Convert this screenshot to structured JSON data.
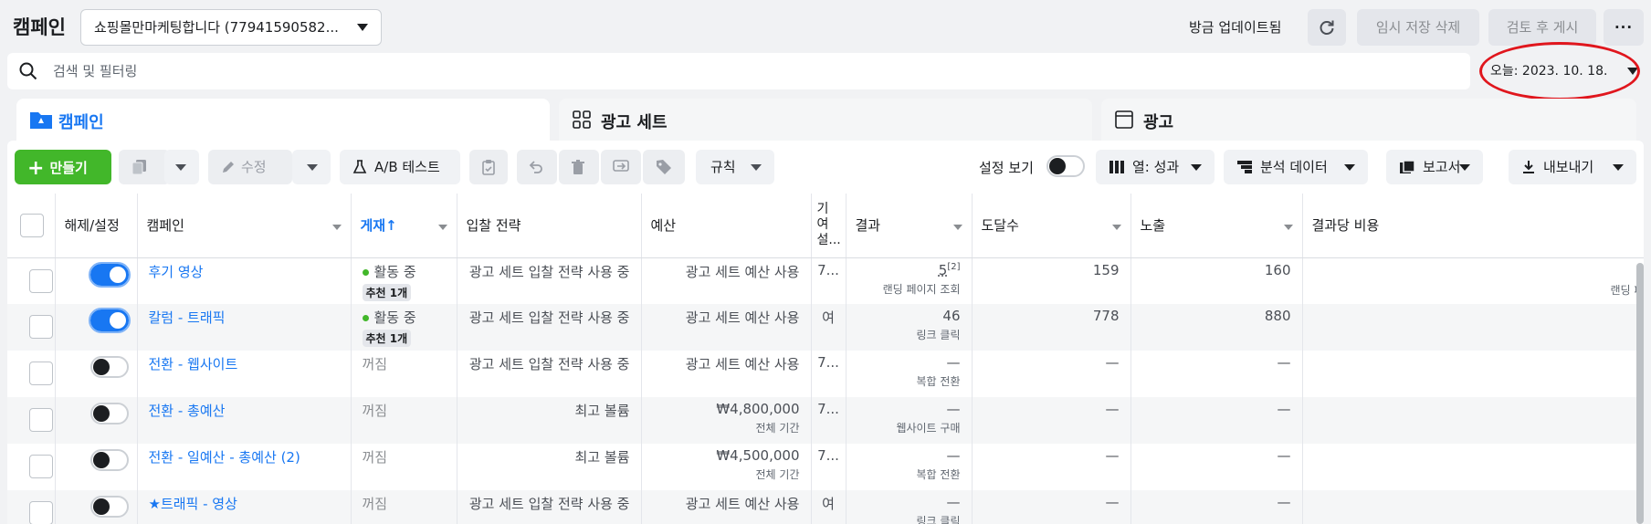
{
  "header": {
    "title": "캠페인",
    "account": "쇼핑몰만마케팅합니다 (77941590582...",
    "updated": "방금 업데이트됨",
    "discard_label": "임시 저장 삭제",
    "publish_label": "검토 후 게시",
    "more_label": "···"
  },
  "search": {
    "placeholder": "검색 및 필터링"
  },
  "date_range": "오늘: 2023. 10. 18.",
  "tabs": [
    {
      "label": "캠페인"
    },
    {
      "label": "광고 세트"
    },
    {
      "label": "광고"
    }
  ],
  "toolbar": {
    "create": "만들기",
    "edit": "수정",
    "ab_test": "A/B 테스트",
    "rules": "규칙",
    "setting_view": "설정 보기",
    "columns": "열: 성과",
    "analysis": "분석 데이터",
    "report": "보고서",
    "export": "내보내기"
  },
  "columns": [
    "해제/설정",
    "캠페인",
    "게재↑",
    "입찰 전략",
    "예산",
    "기여 설...",
    "결과",
    "도달수",
    "노출",
    "결과당 비용"
  ],
  "rows": [
    {
      "on": true,
      "name": "후기 영상",
      "status": "활동 중",
      "rec": "추천 1개",
      "bid": "광고 세트 입찰 전략 사용 중",
      "budget": "광고 세트 예산 사용",
      "budget_sub": "",
      "attr": "7...",
      "result": "5",
      "result_sup": "[2]",
      "result_sub": "랜딩 페이지 조회",
      "reach": "159",
      "impr": "160",
      "cpr": "",
      "cpr_sub": "랜딩 페이"
    },
    {
      "on": true,
      "name": "칼럼 - 트래픽",
      "status": "활동 중",
      "rec": "추천 1개",
      "bid": "광고 세트 입찰 전략 사용 중",
      "budget": "광고 세트 예산 사용",
      "budget_sub": "",
      "attr": "여",
      "result": "46",
      "result_sup": "",
      "result_sub": "링크 클릭",
      "reach": "778",
      "impr": "880",
      "cpr": "",
      "cpr_sub": ""
    },
    {
      "on": false,
      "name": "전환 - 웹사이트",
      "status": "꺼짐",
      "rec": "",
      "bid": "광고 세트 입찰 전략 사용 중",
      "budget": "광고 세트 예산 사용",
      "budget_sub": "",
      "attr": "7...",
      "result": "—",
      "result_sup": "",
      "result_sub": "복합 전환",
      "reach": "—",
      "impr": "—",
      "cpr": "",
      "cpr_sub": ""
    },
    {
      "on": false,
      "name": "전환 - 총예산",
      "status": "꺼짐",
      "rec": "",
      "bid": "최고 볼륨",
      "budget": "₩4,800,000",
      "budget_sub": "전체 기간",
      "attr": "7...",
      "result": "—",
      "result_sup": "",
      "result_sub": "웹사이트 구매",
      "reach": "—",
      "impr": "—",
      "cpr": "",
      "cpr_sub": ""
    },
    {
      "on": false,
      "name": "전환 - 일예산 - 총예산 (2)",
      "status": "꺼짐",
      "rec": "",
      "bid": "최고 볼륨",
      "budget": "₩4,500,000",
      "budget_sub": "전체 기간",
      "attr": "7...",
      "result": "—",
      "result_sup": "",
      "result_sub": "복합 전환",
      "reach": "—",
      "impr": "—",
      "cpr": "",
      "cpr_sub": ""
    },
    {
      "on": false,
      "name": "★트래픽 - 영상",
      "status": "꺼짐",
      "rec": "",
      "bid": "광고 세트 입찰 전략 사용 중",
      "budget": "광고 세트 예산 사용",
      "budget_sub": "",
      "attr": "여",
      "result": "—",
      "result_sup": "",
      "result_sub": "링크 클릭",
      "reach": "—",
      "impr": "—",
      "cpr": "",
      "cpr_sub": ""
    }
  ],
  "colors": {
    "accent": "#1877f2",
    "create": "#42b72a",
    "annotation": "#e0161d"
  }
}
